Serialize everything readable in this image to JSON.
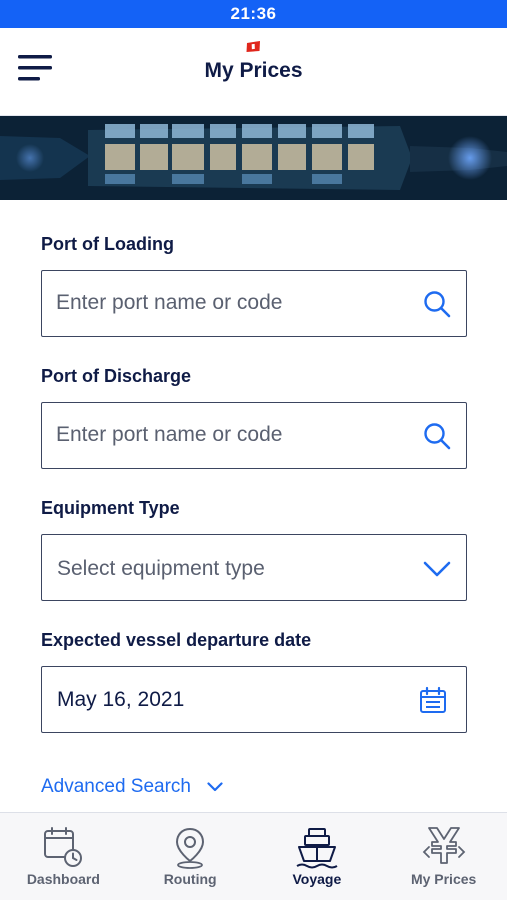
{
  "status_bar": {
    "time": "21:36"
  },
  "header": {
    "title": "My Prices",
    "menu_icon": "hamburger-menu-icon",
    "brand_icon": "brand-flag-icon"
  },
  "form": {
    "loading": {
      "label": "Port of Loading",
      "placeholder": "Enter port name or code",
      "icon": "search-icon"
    },
    "discharge": {
      "label": "Port of Discharge",
      "placeholder": "Enter port name or code",
      "icon": "search-icon"
    },
    "equipment": {
      "label": "Equipment Type",
      "placeholder": "Select equipment type",
      "icon": "chevron-down-icon"
    },
    "departure": {
      "label": "Expected vessel departure date",
      "value": "May 16, 2021",
      "icon": "calendar-icon"
    },
    "advanced_search": "Advanced Search"
  },
  "tabs": [
    {
      "label": "Dashboard",
      "icon": "dashboard-calendar-clock-icon",
      "active": false
    },
    {
      "label": "Routing",
      "icon": "map-pin-icon",
      "active": false
    },
    {
      "label": "Voyage",
      "icon": "ship-icon",
      "active": true
    },
    {
      "label": "My Prices",
      "icon": "yen-price-tag-icon",
      "active": false
    }
  ],
  "colors": {
    "status_bar": "#1462f6",
    "primary_text": "#0f1b46",
    "accent": "#1e6bf0",
    "border": "#3b4560"
  }
}
